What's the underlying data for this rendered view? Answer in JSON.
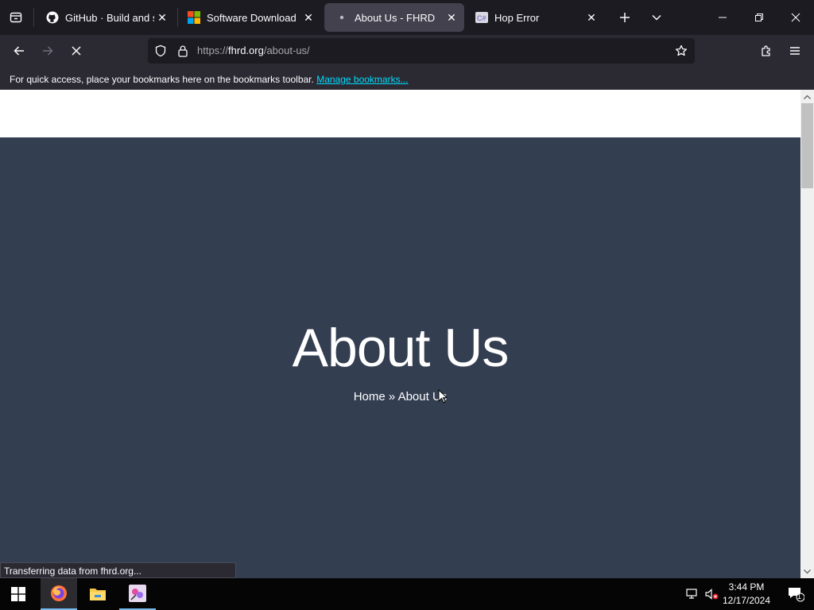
{
  "tabs": [
    {
      "title": "GitHub · Build and ship",
      "icon": "github-icon"
    },
    {
      "title": "Software Download",
      "icon": "microsoft-icon"
    },
    {
      "title": "About Us - FHRD",
      "icon": "loading-dot-icon",
      "active": true
    },
    {
      "title": "Hop Error",
      "icon": "hop-icon"
    }
  ],
  "navbar": {
    "url_prefix": "https://",
    "url_domain": "fhrd.org",
    "url_path": "/about-us/"
  },
  "bookmarks": {
    "message": "For quick access, place your bookmarks here on the bookmarks toolbar.",
    "manage_link": "Manage bookmarks..."
  },
  "page": {
    "title": "About Us",
    "breadcrumb_home": "Home",
    "breadcrumb_sep": "»",
    "breadcrumb_current": "About Us"
  },
  "status_text": "Transferring data from fhrd.org...",
  "taskbar": {
    "time": "3:44 PM",
    "date": "12/17/2024",
    "notification_count": "1"
  },
  "colors": {
    "hero_bg": "#333e51",
    "link": "#00ddff",
    "chrome_bg": "#1c1b22",
    "toolbar_bg": "#2b2a33"
  }
}
